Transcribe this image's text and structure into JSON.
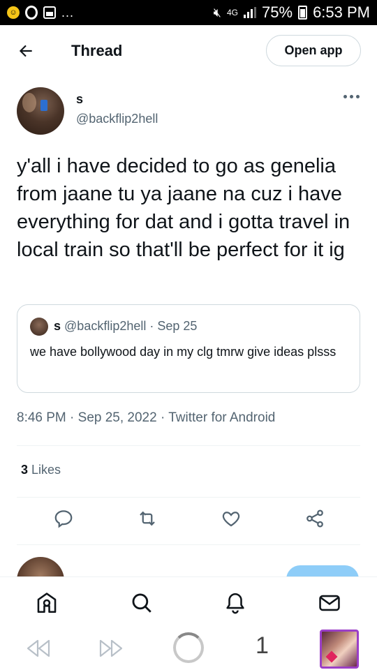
{
  "status_bar": {
    "notif_letter": "0",
    "network": "4G",
    "battery": "75%",
    "time": "6:53 PM",
    "more": "..."
  },
  "header": {
    "title": "Thread",
    "open_app_label": "Open app",
    "back_icon": "arrow-left-icon"
  },
  "tweet": {
    "display_name": "s",
    "handle": "@backflip2hell",
    "text": "y'all i have decided to go as genelia from jaane tu ya jaane na cuz i have everything for dat and i gotta travel in local train so that'll be perfect for it ig",
    "timestamp": "8:46 PM · Sep 25, 2022 · Twitter for Android",
    "likes_count": "3",
    "likes_label": "Likes"
  },
  "quoted_tweet": {
    "display_name": "s",
    "meta": "@backflip2hell · Sep 25",
    "text": "we have bollywood day in my clg tmrw give ideas plsss"
  },
  "actions": [
    "reply-icon",
    "retweet-icon",
    "like-icon",
    "share-icon"
  ],
  "bottom_nav": [
    "home-icon",
    "search-icon",
    "notifications-icon",
    "messages-icon"
  ],
  "browser_bar": {
    "tab_count": "1"
  },
  "colors": {
    "text_primary": "#0f1419",
    "text_secondary": "#536471",
    "border": "#cfd9de",
    "accent_follow": "#8ecdf8",
    "tab_thumb_border": "#9b3fc7"
  }
}
